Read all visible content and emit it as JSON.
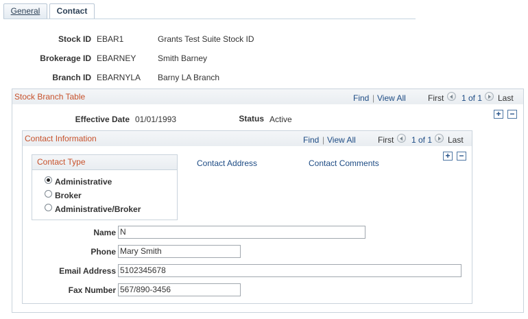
{
  "tabs": {
    "general": "General",
    "contact": "Contact"
  },
  "header": {
    "stock_id_label": "Stock ID",
    "stock_id": "EBAR1",
    "stock_desc": "Grants Test Suite Stock ID",
    "brokerage_id_label": "Brokerage ID",
    "brokerage_id": "EBARNEY",
    "brokerage_desc": "Smith Barney",
    "branch_id_label": "Branch ID",
    "branch_id": "EBARNYLA",
    "branch_desc": "Barny LA Branch"
  },
  "branch_table": {
    "title": "Stock Branch Table",
    "find": "Find",
    "sep": "|",
    "view_all": "View All",
    "first": "First",
    "count": "1 of 1",
    "last": "Last",
    "effective_date_label": "Effective Date",
    "effective_date": "01/01/1993",
    "status_label": "Status",
    "status": "Active",
    "add": "+",
    "remove": "−"
  },
  "contact_info": {
    "title": "Contact Information",
    "find": "Find",
    "sep": "|",
    "view_all": "View All",
    "first": "First",
    "count": "1 of 1",
    "last": "Last",
    "add": "+",
    "remove": "−",
    "contact_address_link": "Contact Address",
    "contact_comments_link": "Contact Comments",
    "contact_type": {
      "title": "Contact Type",
      "options": [
        "Administrative",
        "Broker",
        "Administrative/Broker"
      ],
      "selected": "Administrative"
    },
    "name_label": "Name",
    "name": "N",
    "phone_label": "Phone",
    "phone": "Mary Smith",
    "email_label": "Email Address",
    "email": "5102345678",
    "fax_label": "Fax Number",
    "fax": "567/890-3456"
  }
}
